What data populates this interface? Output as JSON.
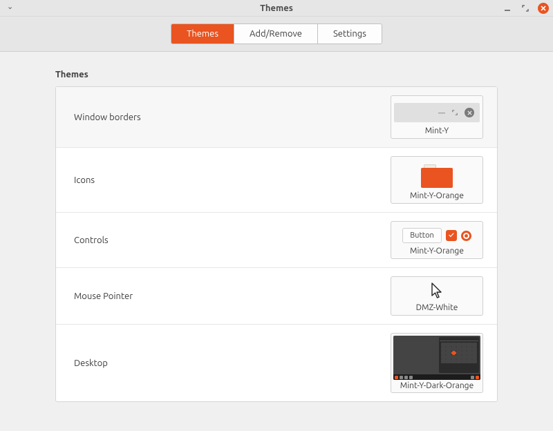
{
  "window": {
    "title": "Themes"
  },
  "tabs": {
    "themes": "Themes",
    "addremove": "Add/Remove",
    "settings": "Settings",
    "active": "themes"
  },
  "section": {
    "title": "Themes"
  },
  "rows": {
    "window_borders": {
      "label": "Window borders",
      "value": "Mint-Y"
    },
    "icons": {
      "label": "Icons",
      "value": "Mint-Y-Orange"
    },
    "controls": {
      "label": "Controls",
      "value": "Mint-Y-Orange",
      "button_sample": "Button"
    },
    "mouse_pointer": {
      "label": "Mouse Pointer",
      "value": "DMZ-White"
    },
    "desktop": {
      "label": "Desktop",
      "value": "Mint-Y-Dark-Orange"
    }
  },
  "colors": {
    "accent": "#e95420"
  }
}
